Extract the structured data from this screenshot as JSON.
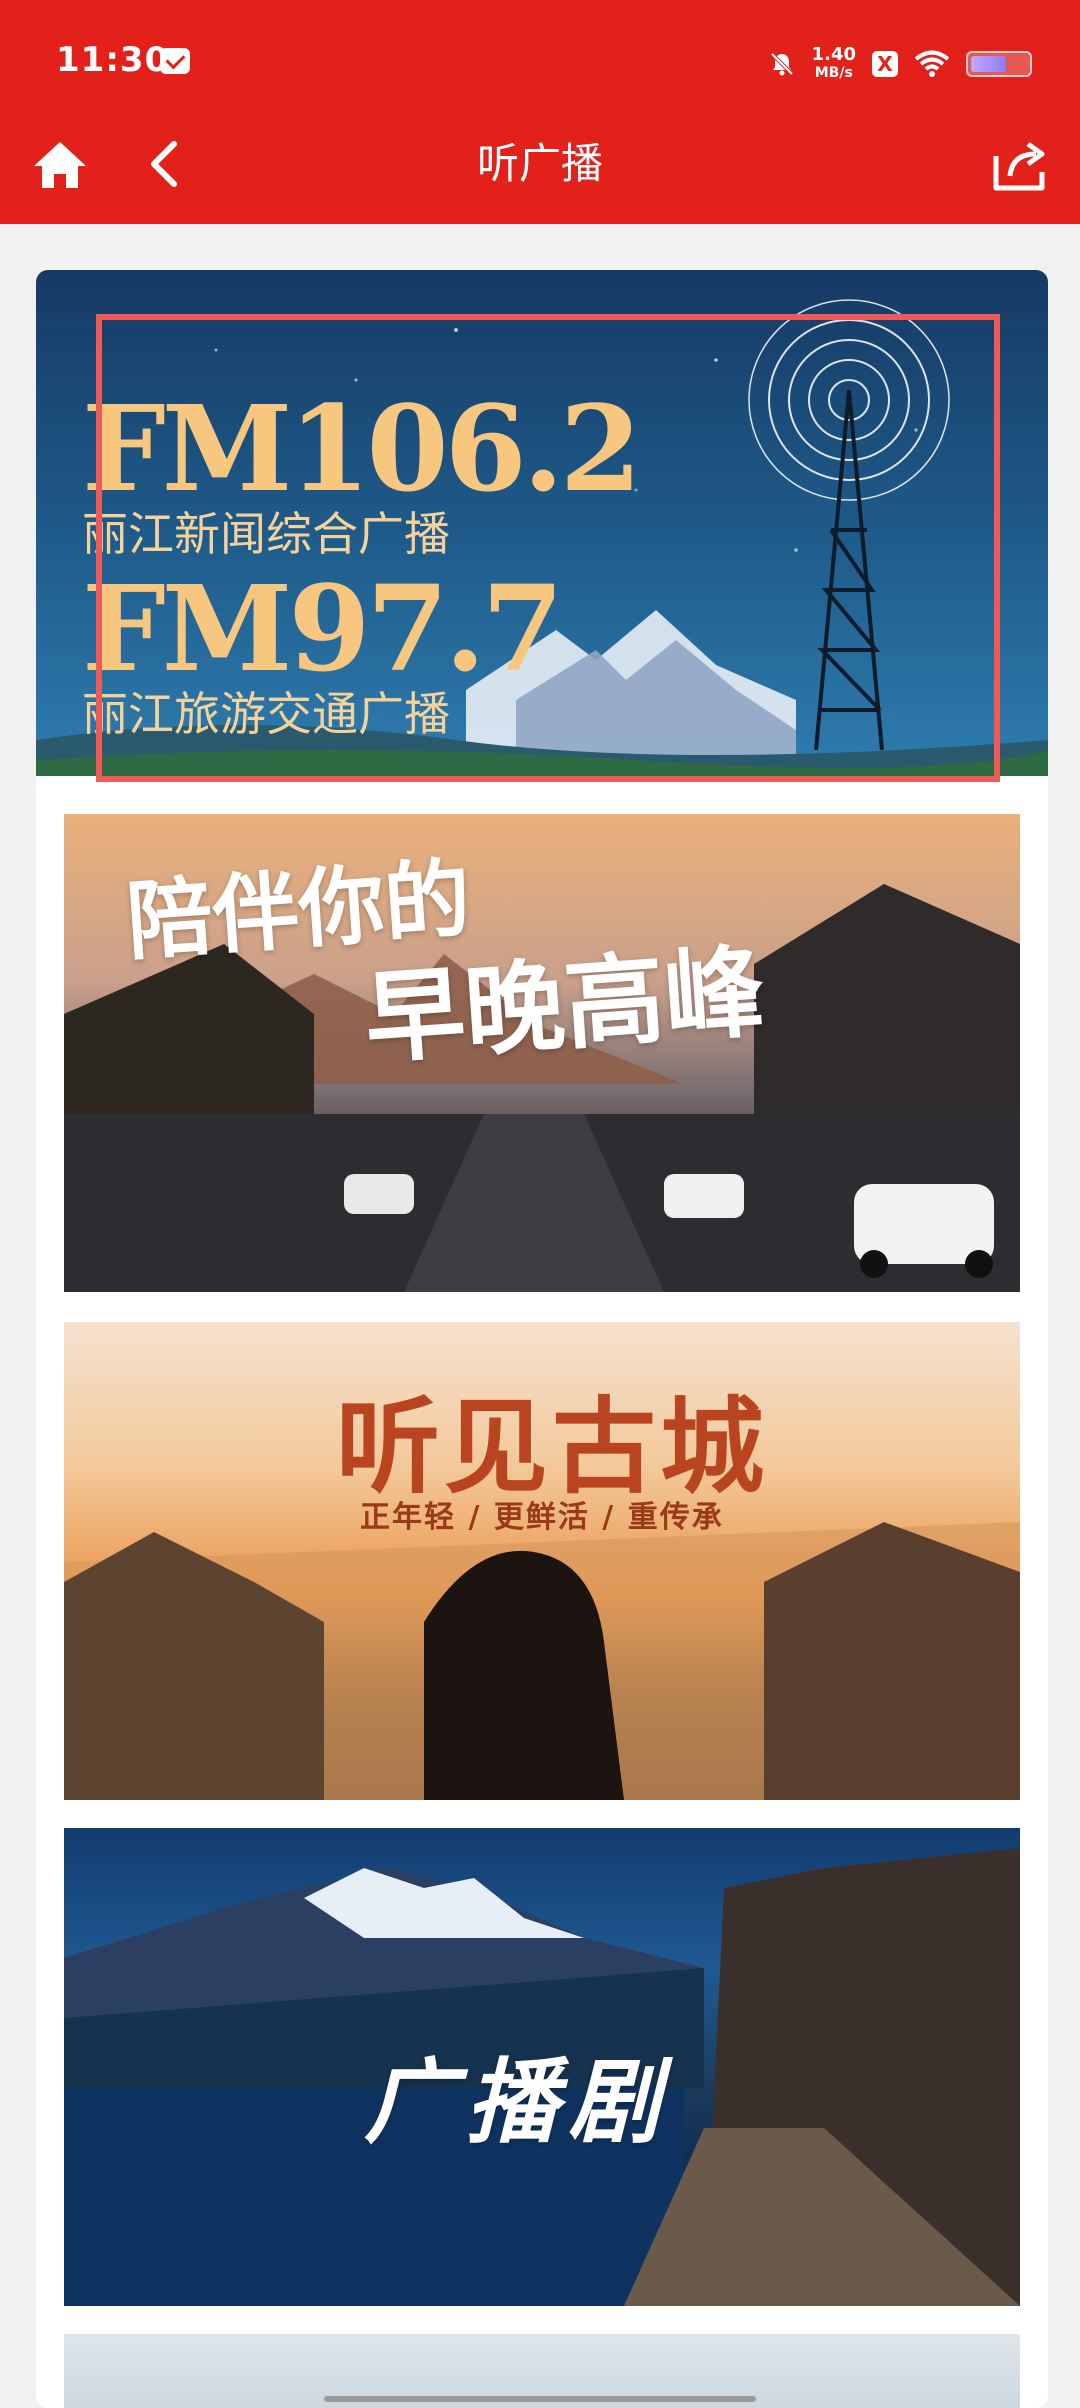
{
  "status_bar": {
    "time": "11:30",
    "net_speed_value": "1.40",
    "net_speed_unit": "MB/s",
    "x_badge": "X",
    "battery_level": 0.62,
    "colors": {
      "background": "#e1211a"
    }
  },
  "nav": {
    "title": "听广播",
    "home_icon": "home-icon",
    "back_icon": "chevron-left-icon",
    "share_icon": "share-icon"
  },
  "banners": {
    "hero": {
      "freq1": "FM106.2",
      "station1": "丽江新闻综合广播",
      "freq2": "FM97.7",
      "station2": "丽江旅游交通广播"
    },
    "rush_hour": {
      "line1": "陪伴你的",
      "line2": "早晚高峰"
    },
    "ancient_town": {
      "title": "听见古城",
      "subtitle": "正年轻 / 更鲜活 / 重传承"
    },
    "radio_drama": {
      "title": "广播剧"
    }
  }
}
